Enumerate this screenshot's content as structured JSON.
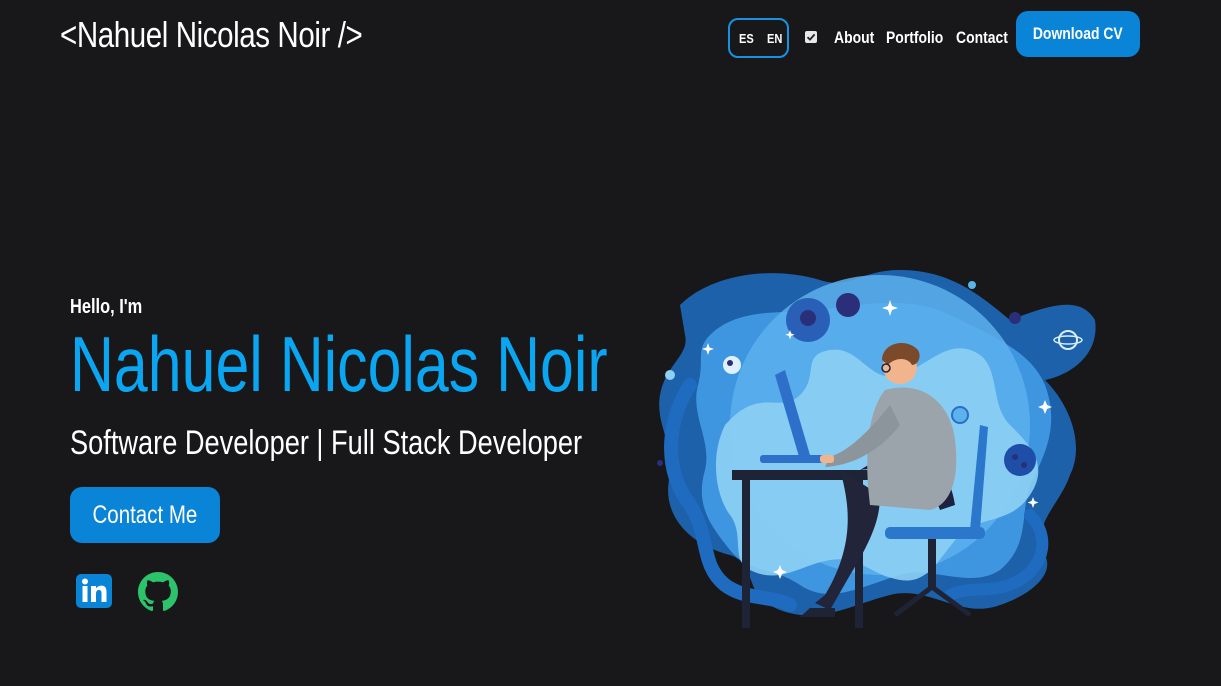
{
  "header": {
    "brand": "<Nahuel Nicolas Noir />",
    "lang": {
      "es": "ES",
      "en": "EN"
    },
    "nav": [
      {
        "label": "About"
      },
      {
        "label": "Portfolio"
      },
      {
        "label": "Contact"
      }
    ],
    "download_label": "Download CV"
  },
  "hero": {
    "greeting": "Hello, I'm",
    "name": "Nahuel Nicolas Noir",
    "role": "Software Developer | Full Stack Developer",
    "contact_label": "Contact Me"
  },
  "social": [
    {
      "icon": "linkedin-icon"
    },
    {
      "icon": "github-icon"
    }
  ],
  "colors": {
    "background": "#18171a",
    "accent": "#0a84d6",
    "name": "#0aa6f2",
    "github": "#2cc36b"
  }
}
